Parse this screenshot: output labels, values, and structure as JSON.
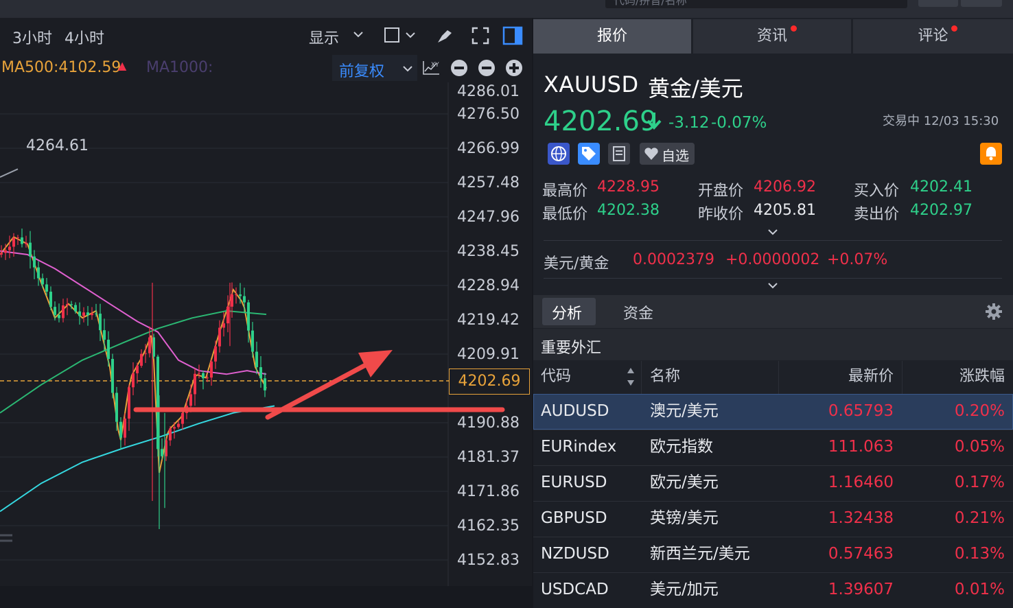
{
  "top": {
    "search_placeholder": "代码/拼音/名称"
  },
  "chart_toolbar": {
    "periods": [
      "3小时",
      "4小时"
    ],
    "display_label": "显示",
    "adjust_label": "前复权",
    "xy_label": "XY"
  },
  "indicators": {
    "ma500": "MA500:4102.59",
    "ma1000": "MA1000:"
  },
  "chart_data": {
    "type": "candlestick",
    "price_axis_ticks": [
      "4286.01",
      "4276.50",
      "4266.99",
      "4257.48",
      "4247.96",
      "4238.45",
      "4228.94",
      "4219.42",
      "4209.91",
      "4202.69",
      "4190.88",
      "4181.37",
      "4171.86",
      "4162.35",
      "4152.83"
    ],
    "current_price": "4202.69",
    "annotation_high": "4264.61",
    "ylim": [
      4152.83,
      4286.01
    ]
  },
  "right": {
    "tabs": [
      {
        "label": "报价"
      },
      {
        "label": "资讯"
      },
      {
        "label": "评论"
      }
    ],
    "symbol": "XAUUSD",
    "name": "黄金/美元",
    "last": "4202.69",
    "change": "-3.12",
    "change_pct": "-0.07%",
    "status": "交易中 12/03 15:30",
    "watch_label": "自选",
    "stats": {
      "high_label": "最高价",
      "high": "4228.95",
      "low_label": "最低价",
      "low": "4202.38",
      "open_label": "开盘价",
      "open": "4206.92",
      "prev_label": "昨收价",
      "prev": "4205.81",
      "bid_label": "买入价",
      "bid": "4202.41",
      "ask_label": "卖出价",
      "ask": "4202.97"
    },
    "inverse": {
      "label": "美元/黄金",
      "price": "0.0002379",
      "change": "+0.0000002",
      "pct": "+0.07%"
    },
    "subtabs": [
      "分析",
      "资金"
    ],
    "section_title": "重要外汇",
    "table_headers": {
      "code": "代码",
      "name": "名称",
      "last": "最新价",
      "pct": "涨跌幅"
    },
    "rows": [
      {
        "code": "AUDUSD",
        "name": "澳元/美元",
        "last": "0.65793",
        "pct": "0.20%"
      },
      {
        "code": "EURindex",
        "name": "欧元指数",
        "last": "111.063",
        "pct": "0.05%"
      },
      {
        "code": "EURUSD",
        "name": "欧元/美元",
        "last": "1.16460",
        "pct": "0.17%"
      },
      {
        "code": "GBPUSD",
        "name": "英镑/美元",
        "last": "1.32438",
        "pct": "0.21%"
      },
      {
        "code": "NZDUSD",
        "name": "新西兰元/美元",
        "last": "0.57463",
        "pct": "0.13%"
      },
      {
        "code": "USDCAD",
        "name": "美元/加元",
        "last": "1.39607",
        "pct": "0.01%"
      }
    ]
  },
  "colors": {
    "up": "#f0304a",
    "down": "#2ed08a",
    "accent": "#e8a33a",
    "selected_row": "#2a3d5c"
  }
}
